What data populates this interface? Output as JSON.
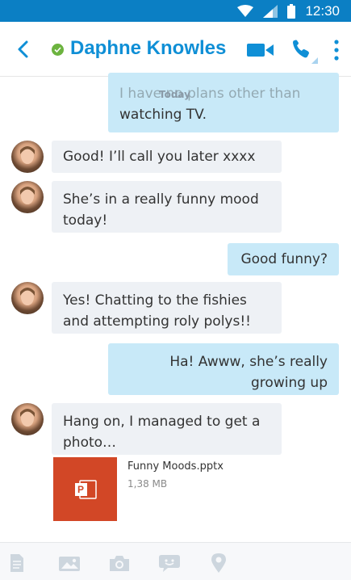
{
  "status_bar": {
    "time": "12:30"
  },
  "header": {
    "contact_name": "Daphne Knowles",
    "presence": "online"
  },
  "chat": {
    "date_divider": "Today",
    "messages": [
      {
        "direction": "out",
        "lines": [
          "I have no plans other than",
          "watching TV."
        ]
      },
      {
        "direction": "in",
        "lines": [
          "Good! I’ll call you later xxxx"
        ]
      },
      {
        "direction": "in",
        "lines": [
          "She’s in a really funny mood",
          "today!"
        ]
      },
      {
        "direction": "out",
        "lines": [
          "Good funny?"
        ]
      },
      {
        "direction": "in",
        "lines": [
          "Yes! Chatting to the fishies",
          "and attempting roly polys!!"
        ]
      },
      {
        "direction": "out",
        "lines": [
          "Ha! Awww, she’s really",
          "growing up"
        ]
      },
      {
        "direction": "in",
        "lines": [
          "Hang on, I managed to get a",
          "photo…"
        ]
      }
    ],
    "attachment": {
      "file_name": "Funny Moods.pptx",
      "file_size": "1,38 MB",
      "icon": "powerpoint-icon",
      "badge": "P"
    }
  },
  "toolbar": {
    "items": [
      "file-icon",
      "photo-gallery-icon",
      "camera-icon",
      "emoticon-icon",
      "location-icon"
    ]
  },
  "colors": {
    "status_bar": "#0b7fc4",
    "accent": "#0f8fd6",
    "presence_online": "#6cb33f",
    "incoming_bubble": "#eef1f5",
    "outgoing_bubble": "#c8e9f8",
    "powerpoint": "#d24726"
  }
}
